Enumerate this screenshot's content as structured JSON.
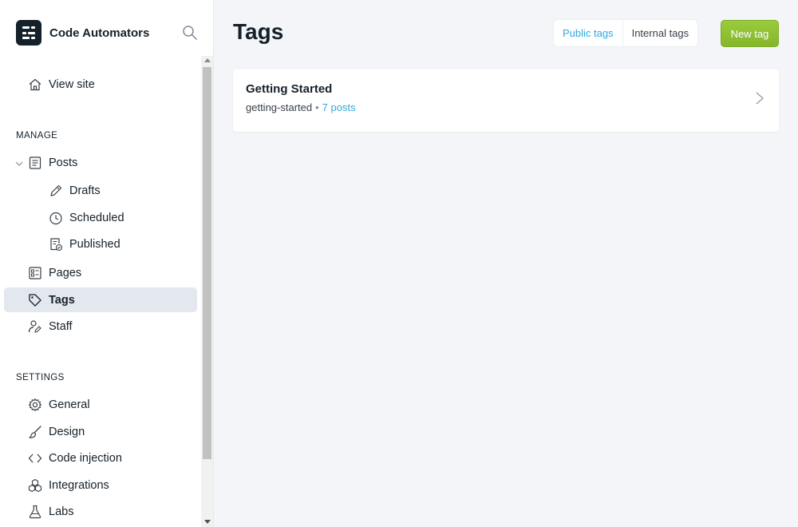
{
  "sidebar": {
    "brand": "Code Automators",
    "top_items": [
      {
        "label": "View site",
        "icon": "home-icon"
      }
    ],
    "manage": {
      "title": "MANAGE",
      "posts": "Posts",
      "drafts": "Drafts",
      "scheduled": "Scheduled",
      "published": "Published",
      "pages": "Pages",
      "tags": "Tags",
      "staff": "Staff"
    },
    "settings": {
      "title": "SETTINGS",
      "general": "General",
      "design": "Design",
      "code_injection": "Code injection",
      "integrations": "Integrations",
      "labs": "Labs"
    }
  },
  "main": {
    "title": "Tags",
    "filters": [
      "Public tags",
      "Internal tags"
    ],
    "new_button": "New tag",
    "tags": [
      {
        "name": "Getting Started",
        "slug": "getting-started",
        "posts": "7 posts"
      }
    ]
  },
  "colors": {
    "accent_blue": "#30a9de",
    "primary_green": "#9acb3c",
    "sidebar_active": "#e3e7ee",
    "page_bg": "#f4f5f8"
  }
}
